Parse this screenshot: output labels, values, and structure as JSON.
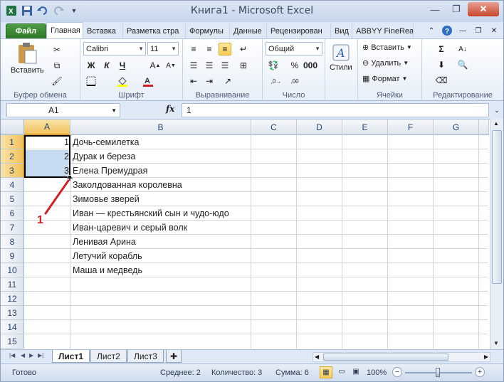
{
  "window": {
    "title": "Книга1 - Microsoft Excel"
  },
  "tabs": [
    "Файл",
    "Главная",
    "Вставка",
    "Разметка стра",
    "Формулы",
    "Данные",
    "Рецензирован",
    "Вид",
    "ABBYY FineRea"
  ],
  "ribbon": {
    "clipboard": {
      "paste": "Вставить",
      "label": "Буфер обмена"
    },
    "font": {
      "name": "Calibri",
      "size": "11",
      "bold": "Ж",
      "italic": "К",
      "underline": "Ч",
      "label": "Шрифт"
    },
    "alignment": {
      "label": "Выравнивание"
    },
    "number": {
      "format": "Общий",
      "label": "Число"
    },
    "styles": {
      "label": "Стили"
    },
    "cells": {
      "insert": "Вставить",
      "delete": "Удалить",
      "format": "Формат",
      "label": "Ячейки"
    },
    "editing": {
      "label": "Редактирование"
    }
  },
  "formula_bar": {
    "name_box": "A1",
    "fx": "fx",
    "value": "1"
  },
  "columns": [
    "A",
    "B",
    "C",
    "D",
    "E",
    "F",
    "G"
  ],
  "rows": [
    "1",
    "2",
    "3",
    "4",
    "5",
    "6",
    "7",
    "8",
    "9",
    "10",
    "11",
    "12",
    "13",
    "14",
    "15"
  ],
  "cells": {
    "a": [
      "1",
      "2",
      "3"
    ],
    "b": [
      "Дочь-семилетка",
      "Дурак и береза",
      "Елена Премудрая",
      "Заколдованная королевна",
      "Зимовье зверей",
      "Иван — крестьянский сын и чудо-юдо",
      "Иван-царевич и серый волк",
      "Ленивая Арина",
      "Летучий корабль",
      "Маша и медведь"
    ]
  },
  "annotation": "1",
  "sheets": [
    "Лист1",
    "Лист2",
    "Лист3"
  ],
  "status": {
    "ready": "Готово",
    "average": "Среднее: 2",
    "count": "Количество: 3",
    "sum": "Сумма: 6",
    "zoom": "100%"
  },
  "colors": {
    "accent": "#2e7a28",
    "selection": "#c6dbf2",
    "annotation": "#d0202a"
  }
}
